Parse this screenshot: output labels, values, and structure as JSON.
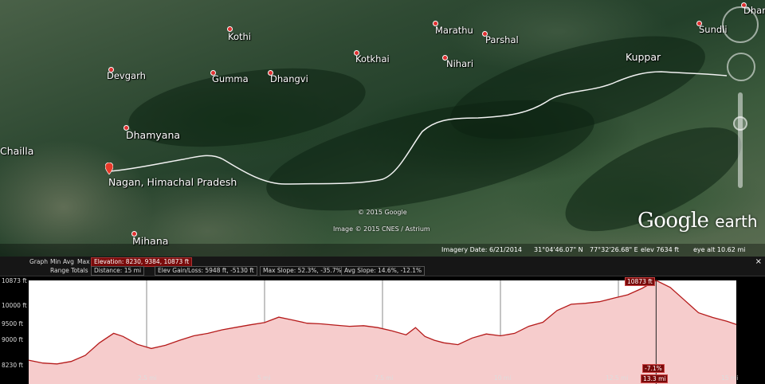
{
  "places": [
    {
      "name": "Kothi"
    },
    {
      "name": "Devgarh"
    },
    {
      "name": "Gumma"
    },
    {
      "name": "Dhangvi"
    },
    {
      "name": "Kotkhai"
    },
    {
      "name": "Marathu"
    },
    {
      "name": "Parshal"
    },
    {
      "name": "Nihari"
    },
    {
      "name": "Kuppar"
    },
    {
      "name": "Sundli"
    },
    {
      "name": "Dhar"
    },
    {
      "name": "Dhamyana"
    },
    {
      "name": "Chailla"
    },
    {
      "name": "Nagan, Himachal Pradesh"
    },
    {
      "name": "Mihana"
    }
  ],
  "copyright": {
    "google": "© 2015 Google",
    "cnes": "Image © 2015 CNES / Astrium"
  },
  "logo": {
    "brand": "Google",
    "product": "earth"
  },
  "status": {
    "imagery_date": "Imagery Date: 6/21/2014",
    "lat": "31°04'46.07\" N",
    "lon": "77°32'26.68\" E",
    "elev": "elev  7634 ft",
    "eye_alt": "eye alt  10.62 mi"
  },
  "toolbar": {
    "graph": "Graph",
    "min": "Min",
    "avg": "Avg",
    "max": "Max",
    "elevation": "Elevation: 8230, 9384, 10873 ft",
    "range_totals": "Range Totals",
    "distance": "Distance: 15 mi",
    "elev_gain_loss": "Elev Gain/Loss: 5948 ft, -5130 ft",
    "max_slope": "Max Slope: 52.3%, -35.7%",
    "avg_slope": "Avg Slope: 14.6%, -12.1%",
    "close": "×"
  },
  "profile": {
    "peak_label": "10873 ft",
    "cursor_slope": "-7.1%",
    "cursor_distance": "13.3 mi"
  },
  "chart_data": {
    "type": "area",
    "xlabel": "",
    "ylabel": "",
    "x_ticks": [
      "2.5 mi",
      "5 mi",
      "7.5 mi",
      "10 mi",
      "12.5 mi",
      "15 mi"
    ],
    "y_ticks": [
      "8230 ft",
      "9000 ft",
      "9500 ft",
      "10000 ft",
      "10873 ft"
    ],
    "xlim": [
      0,
      15
    ],
    "ylim": [
      8100,
      10873
    ],
    "series": [
      {
        "x": [
          0,
          0.3,
          0.6,
          0.9,
          1.2,
          1.5,
          1.8,
          2.0,
          2.3,
          2.6,
          2.9,
          3.2,
          3.5,
          3.8,
          4.1,
          4.4,
          4.7,
          5.0,
          5.3,
          5.6,
          5.9,
          6.2,
          6.5,
          6.8,
          7.1,
          7.4,
          7.7,
          8.0,
          8.2,
          8.4,
          8.6,
          8.8,
          9.1,
          9.4,
          9.7,
          10.0,
          10.3,
          10.6,
          10.9,
          11.2,
          11.5,
          11.8,
          12.1,
          12.4,
          12.7,
          13.0,
          13.3,
          13.6,
          13.9,
          14.2,
          14.5,
          14.8,
          15.0
        ],
        "y": [
          8350,
          8260,
          8230,
          8310,
          8500,
          8900,
          9200,
          9100,
          8850,
          8720,
          8820,
          8980,
          9120,
          9200,
          9310,
          9390,
          9470,
          9540,
          9710,
          9620,
          9520,
          9500,
          9460,
          9420,
          9440,
          9380,
          9280,
          9150,
          9380,
          9100,
          8980,
          8900,
          8840,
          9050,
          9180,
          9120,
          9200,
          9420,
          9550,
          9920,
          10120,
          10150,
          10200,
          10310,
          10420,
          10620,
          10873,
          10650,
          10250,
          9850,
          9700,
          9580,
          9480
        ]
      }
    ]
  }
}
